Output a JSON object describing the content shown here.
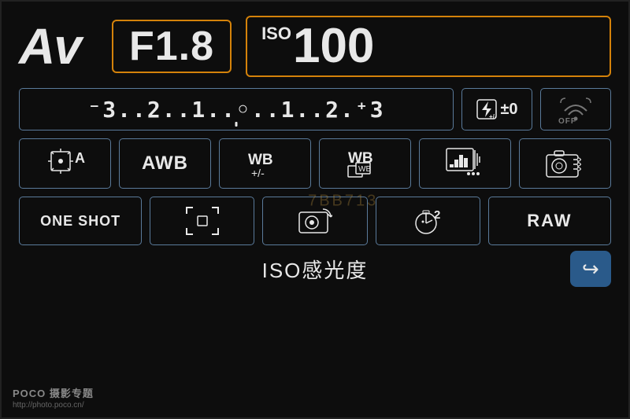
{
  "mode": {
    "label": "Av"
  },
  "aperture": {
    "value": "F1.8",
    "border_color": "#d4820a"
  },
  "iso": {
    "superscript": "ISO",
    "value": "100",
    "border_color": "#d4820a"
  },
  "exposure_scale": {
    "display": "⁻3..2..1..0..1..2.⁺3",
    "text": "-3..2..1..0..1..2.+3"
  },
  "flash_comp": {
    "label": "±0"
  },
  "wifi": {
    "label": "OFF"
  },
  "settings_row": [
    {
      "id": "metering",
      "type": "metering",
      "label": "A"
    },
    {
      "id": "awb",
      "type": "awb",
      "label": "AWB"
    },
    {
      "id": "wb-adjust",
      "type": "wb-adjust",
      "label": "WB",
      "sublabel": "+/-"
    },
    {
      "id": "wb-bracket",
      "type": "wb-bracket",
      "label": "WB"
    },
    {
      "id": "histogram",
      "type": "histogram"
    },
    {
      "id": "camera-settings",
      "type": "camera-settings"
    }
  ],
  "bottom_row": [
    {
      "id": "one-shot",
      "label": "ONE SHOT"
    },
    {
      "id": "af-point",
      "type": "af-point"
    },
    {
      "id": "live-view",
      "type": "live-view"
    },
    {
      "id": "self-timer",
      "label": "2",
      "type": "self-timer"
    },
    {
      "id": "raw",
      "label": "RAW"
    }
  ],
  "iso_label": "ISO感光度",
  "watermark": {
    "line1": "POCO 摄影专题",
    "line2": "http://photo.poco.cn/"
  },
  "center_watermark": "7BB713",
  "back_button_label": "↩"
}
